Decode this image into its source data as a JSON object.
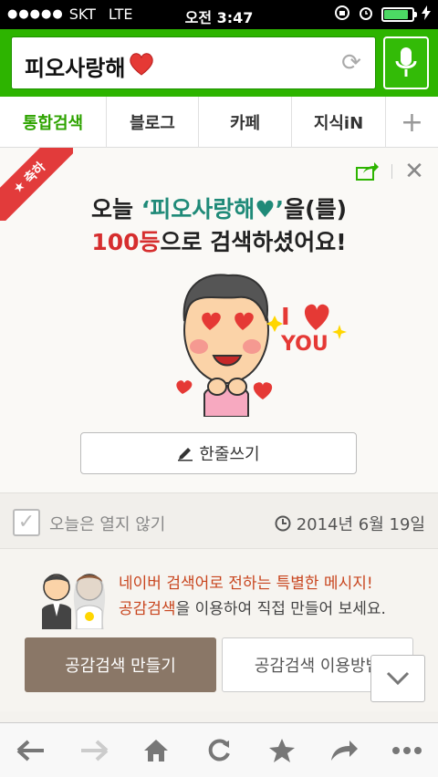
{
  "status_bar": {
    "carrier": "SKT",
    "network": "LTE",
    "time": "오전 3:47",
    "battery_level": 0.85
  },
  "search": {
    "query": "피오사랑해"
  },
  "tabs": [
    {
      "label": "통합검색",
      "active": true
    },
    {
      "label": "블로그",
      "active": false
    },
    {
      "label": "카페",
      "active": false
    },
    {
      "label": "지식iN",
      "active": false
    },
    {
      "label": "+",
      "active": false
    }
  ],
  "card": {
    "ribbon_label": "축하",
    "headline_prefix": "오늘 ",
    "headline_query": "‘피오사랑해♥’",
    "headline_suffix": "을(를)",
    "rank": "100등",
    "rank_suffix": "으로 검색하셨어요!",
    "illustration_text_top": "I",
    "illustration_text_bottom": "YOU",
    "write_button": "한줄쓰기"
  },
  "options": {
    "dont_open_today": "오늘은 열지 않기",
    "date": "2014년 6월 19일"
  },
  "promo": {
    "line1": "네이버 검색어로 전하는 특별한 메시지!",
    "line2_highlight": "공감검색",
    "line2_rest": "을 이용하여 직접 만들어 보세요.",
    "make_button": "공감검색 만들기",
    "howto_button": "공감검색 이용방법"
  },
  "colors": {
    "naver_green": "#2db400",
    "active_tab": "#2ea300",
    "rank_red": "#d62e2e",
    "query_teal": "#1f8a78",
    "ribbon_red": "#e23b3b",
    "make_button_bg": "#8a7767"
  },
  "toolbar": {
    "icons": [
      "back-icon",
      "forward-icon",
      "home-icon",
      "refresh-icon",
      "bookmark-icon",
      "share-icon",
      "more-icon"
    ]
  }
}
